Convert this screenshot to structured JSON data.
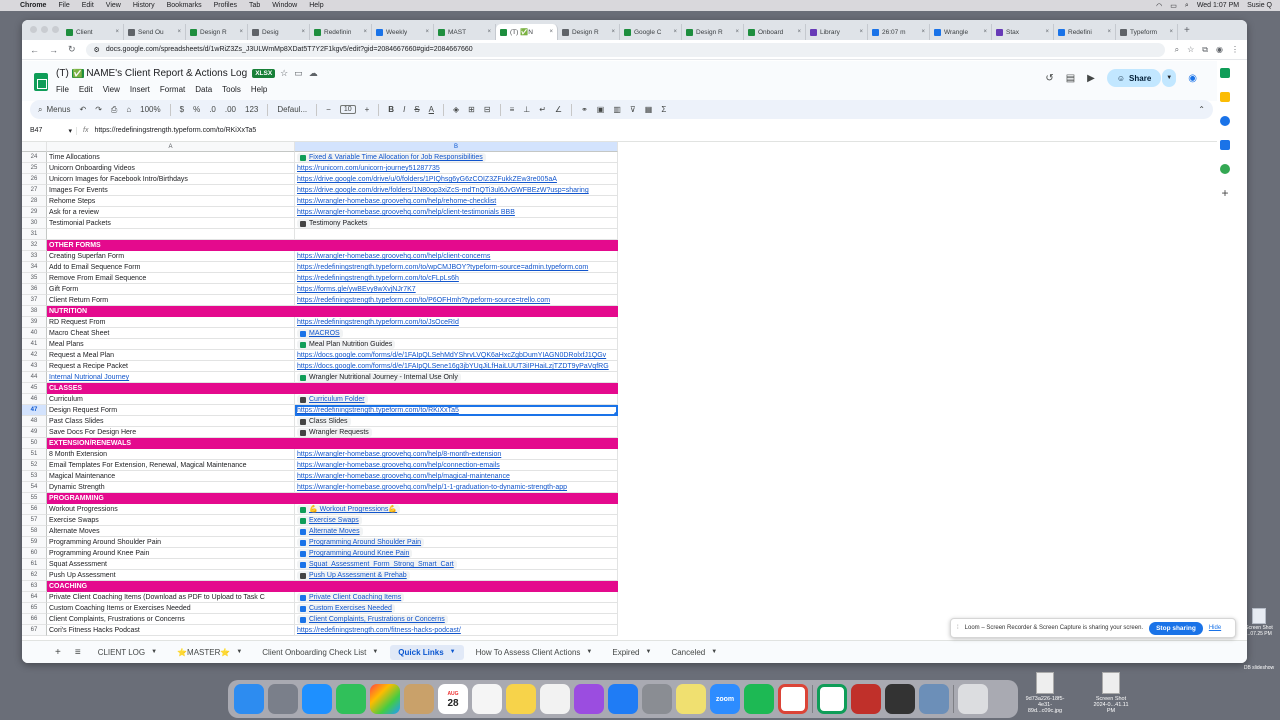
{
  "menubar": {
    "app": "Chrome",
    "items": [
      "File",
      "Edit",
      "View",
      "History",
      "Bookmarks",
      "Profiles",
      "Tab",
      "Window",
      "Help"
    ],
    "clock": "Wed 1:07 PM",
    "user": "Susie Q"
  },
  "tabs": [
    {
      "label": "Client",
      "fav": "green"
    },
    {
      "label": "Send Ou",
      "fav": "gray"
    },
    {
      "label": "Design R",
      "fav": "green"
    },
    {
      "label": "Desig",
      "fav": "gray"
    },
    {
      "label": "Redefinin",
      "fav": "green"
    },
    {
      "label": "Weekly",
      "fav": "blue"
    },
    {
      "label": "MAST",
      "fav": "green"
    },
    {
      "label": "(T) ✅N",
      "fav": "green",
      "active": true
    },
    {
      "label": "Design R",
      "fav": "gray"
    },
    {
      "label": "Google C",
      "fav": "green"
    },
    {
      "label": "Design R",
      "fav": "green"
    },
    {
      "label": "Onboard",
      "fav": "green"
    },
    {
      "label": "Library",
      "fav": "purple"
    },
    {
      "label": "26:07 m",
      "fav": "blue"
    },
    {
      "label": "Wrangle",
      "fav": "blue"
    },
    {
      "label": "Stax",
      "fav": "purple"
    },
    {
      "label": "Redefini",
      "fav": "blue"
    },
    {
      "label": "Typeform",
      "fav": "gray"
    }
  ],
  "address": {
    "url": "docs.google.com/spreadsheets/d/1wRiZ3Zs_J3ULWmMp8XDat5T7Y2F1kgv5/edit?gid=2084667660#gid=2084667660"
  },
  "doc": {
    "title_prefix": "(T)",
    "title_check": "✅",
    "title_main": "NAME's Client Report & Actions Log",
    "badge": "XLSX",
    "menus": [
      "File",
      "Edit",
      "View",
      "Insert",
      "Format",
      "Data",
      "Tools",
      "Help"
    ],
    "share_label": "Share"
  },
  "toolbar": {
    "menus_label": "Menus",
    "zoom": "100%",
    "currency": "$",
    "percent": "%",
    "format_123": "123",
    "font": "Defaul...",
    "font_size": "10"
  },
  "formula": {
    "cell_ref": "B47",
    "fx": "fx",
    "content": "https://redefiningstrength.typeform.com/to/RKiXxTa5"
  },
  "columns": {
    "a": "A",
    "b": "B"
  },
  "rows": [
    {
      "n": "24",
      "a": "Time Allocations",
      "b": "Fixed & Variable Time Allocation for Job Responsibilities",
      "bt": "chip",
      "ic": "sheet"
    },
    {
      "n": "25",
      "a": "Unicorn Onboarding Videos",
      "b": "https://runicorn.com/unicorn-journey51287735",
      "bt": "link"
    },
    {
      "n": "26",
      "a": "Unicorn Images for Facebook Intro/Birthdays",
      "b": "https://drive.google.com/drive/u/0/folders/1PIQhsg6yG6zCOIZ3ZFukkZEw3re005aA",
      "bt": "link"
    },
    {
      "n": "27",
      "a": "Images For Events",
      "b": "https://drive.google.com/drive/folders/1N80op3xiZcS-mdTnQTi3ul6JvGWFBEzW?usp=sharing",
      "bt": "link"
    },
    {
      "n": "28",
      "a": "Rehome Steps",
      "b": "https://wrangler-homebase.groovehq.com/help/rehome-checklist",
      "bt": "link"
    },
    {
      "n": "29",
      "a": "Ask for a review",
      "b": "https://wrangler-homebase.groovehq.com/help/client-testimonials  BBB",
      "bt": "link"
    },
    {
      "n": "30",
      "a": "Testimonial Packets",
      "b": "Testimony Packets",
      "bt": "chip-plain",
      "ic": "file"
    },
    {
      "n": "31",
      "a": "",
      "b": "",
      "bt": "text"
    },
    {
      "n": "32",
      "a": "OTHER FORMS",
      "section": true
    },
    {
      "n": "33",
      "a": "Creating Superfan Form",
      "b": "https://wrangler-homebase.groovehq.com/help/client-concerns",
      "bt": "link"
    },
    {
      "n": "34",
      "a": "Add to Email Sequence Form",
      "b": "https://redefiningstrength.typeform.com/to/wpCMJBOY?typeform-source=admin.typeform.com",
      "bt": "link"
    },
    {
      "n": "35",
      "a": "Remove From Email Sequence",
      "b": "https://redefiningstrength.typeform.com/to/cFLpLs6h",
      "bt": "link"
    },
    {
      "n": "36",
      "a": "Gift Form",
      "b": "https://forms.gle/ywBEvy8wXvjNJr7K7",
      "bt": "link"
    },
    {
      "n": "37",
      "a": "Client Return Form",
      "b": "https://redefiningstrength.typeform.com/to/P6OFHmh?typeform-source=trello.com",
      "bt": "link"
    },
    {
      "n": "38",
      "a": "NUTRITION",
      "section": true
    },
    {
      "n": "39",
      "a": "RD Request From",
      "b": "https://redefiningstrength.typeform.com/to/JsOceRId",
      "bt": "link"
    },
    {
      "n": "40",
      "a": "Macro Cheat Sheet",
      "b": "MACROS",
      "bt": "chip",
      "ic": "doc"
    },
    {
      "n": "41",
      "a": "Meal Plans",
      "b": "Meal Plan Nutrition Guides",
      "bt": "chip-plain",
      "ic": "sheet"
    },
    {
      "n": "42",
      "a": "Request a Meal Plan",
      "b": "https://docs.google.com/forms/d/e/1FAIpQLSehMdYShrvLVQK6aHxcZgbDumYIAGN0DRolxfJ1QGv",
      "bt": "link"
    },
    {
      "n": "43",
      "a": "Request a Recipe Packet",
      "b": "https://docs.google.com/forms/d/e/1FAIpQLSene16g3jbYUqJiLfHaiLUUT3iIPHaiLzjTZDT9yPaVqfRG",
      "bt": "link"
    },
    {
      "n": "44",
      "a": "Internal Nutrional Journey",
      "b": "Wrangler Nutritional Journey - Internal Use Only",
      "bt": "chip-plain",
      "ic": "sheet",
      "a_link": true
    },
    {
      "n": "45",
      "a": "CLASSES",
      "section": true
    },
    {
      "n": "46",
      "a": "Curriculum",
      "b": "Curriculum Folder",
      "bt": "chip",
      "ic": "file"
    },
    {
      "n": "47",
      "a": "Design Request Form",
      "b": "https://redefiningstrength.typeform.com/to/RKiXxTa5",
      "bt": "link",
      "selected": true
    },
    {
      "n": "48",
      "a": "Past Class Slides",
      "b": "Class Slides",
      "bt": "chip-plain",
      "ic": "file"
    },
    {
      "n": "49",
      "a": "Save Docs For Design Here",
      "b": "Wrangler Requests",
      "bt": "chip-plain",
      "ic": "file"
    },
    {
      "n": "50",
      "a": "EXTENSION/RENEWALS",
      "section": true
    },
    {
      "n": "51",
      "a": "8 Month Extension",
      "b": "https://wrangler-homebase.groovehq.com/help/8-month-extension",
      "bt": "link"
    },
    {
      "n": "52",
      "a": "Email Templates For Extension, Renewal, Magical Maintenance",
      "b": "https://wrangler-homebase.groovehq.com/help/connection-emails",
      "bt": "link"
    },
    {
      "n": "53",
      "a": "Magical Maintenance",
      "b": "https://wrangler-homebase.groovehq.com/help/magical-maintenance",
      "bt": "link"
    },
    {
      "n": "54",
      "a": "Dynamic Strength",
      "b": "https://wrangler-homebase.groovehq.com/help/1-1-graduation-to-dynamic-strength-app",
      "bt": "link"
    },
    {
      "n": "55",
      "a": "PROGRAMMING",
      "section": true
    },
    {
      "n": "56",
      "a": "Workout Progressions",
      "b": "💪 Workout Progressions💪",
      "bt": "chip",
      "ic": "sheet"
    },
    {
      "n": "57",
      "a": "Exercise Swaps",
      "b": "Exercise Swaps",
      "bt": "chip",
      "ic": "sheet"
    },
    {
      "n": "58",
      "a": "Alternate Moves",
      "b": "Alternate Moves",
      "bt": "chip",
      "ic": "doc"
    },
    {
      "n": "59",
      "a": "Programming Around Shoulder Pain",
      "b": "Programming Around Shoulder Pain",
      "bt": "chip",
      "ic": "doc"
    },
    {
      "n": "60",
      "a": "Programming Around Knee Pain",
      "b": "Programming Around Knee Pain",
      "bt": "chip",
      "ic": "doc"
    },
    {
      "n": "61",
      "a": "Squat Assessment",
      "b": "Squat_Assessment_Form_Strong_Smart_Cart",
      "bt": "chip",
      "ic": "doc"
    },
    {
      "n": "62",
      "a": "Push Up Assessment",
      "b": "Push Up Assessment & Prehab",
      "bt": "chip",
      "ic": "file"
    },
    {
      "n": "63",
      "a": "COACHING",
      "section": true
    },
    {
      "n": "64",
      "a": "Private Client Coaching Items (Download as PDF to Upload to Task C",
      "b": "Private Client Coaching Items",
      "bt": "chip",
      "ic": "doc"
    },
    {
      "n": "65",
      "a": "Custom Coaching Items or Exercises Needed",
      "b": "Custom Exercises Needed",
      "bt": "chip",
      "ic": "doc"
    },
    {
      "n": "66",
      "a": "Client Complaints, Frustrations or Concerns",
      "b": "Client Complaints, Frustrations or Concerns",
      "bt": "chip",
      "ic": "doc"
    },
    {
      "n": "67",
      "a": "Cori's Fitness Hacks Podcast",
      "b": "https://redefiningstrength.com/fitness-hacks-podcast/",
      "bt": "link"
    }
  ],
  "sheet_tabs": [
    {
      "label": "CLIENT LOG"
    },
    {
      "label": "⭐MASTER⭐"
    },
    {
      "label": "Client Onboarding Check List"
    },
    {
      "label": "Quick Links",
      "active": true
    },
    {
      "label": "How To Assess Client Actions"
    },
    {
      "label": "Expired"
    },
    {
      "label": "Canceled"
    }
  ],
  "loom": {
    "message": "Loom – Screen Recorder & Screen Capture is sharing your screen.",
    "stop": "Stop sharing",
    "hide": "Hide"
  },
  "desktop": {
    "file1_name": "9d73a226-18f5-4e31-89d...c09c.jpg",
    "file2_name": "Screen Shot 2024-0...41.11 PM",
    "right_label_1": "Screen Shot",
    "right_label_2": "...07.25 PM",
    "right_label_3": "DB slideshow",
    "dock_date": "28",
    "dock_month": "AUG",
    "zoom_label": "zoom"
  },
  "colors": {
    "section_bg": "#e40a8d",
    "link": "#1155cc",
    "sheets_green": "#0f9d58",
    "selection": "#1a73e8"
  }
}
